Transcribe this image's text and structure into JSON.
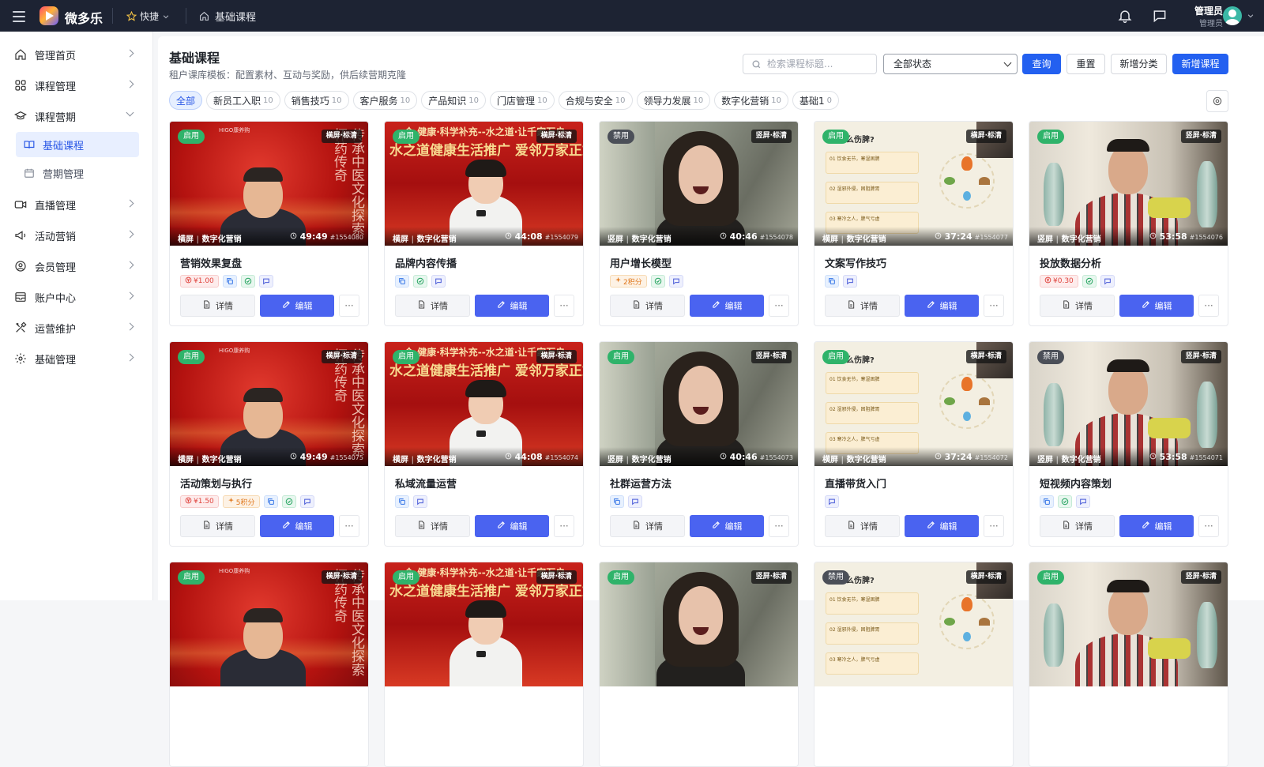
{
  "topbar": {
    "brand": "微多乐",
    "quick": "快捷",
    "crumb": "基础课程",
    "user_name": "管理员",
    "user_role": "管理员"
  },
  "sidebar": {
    "items": [
      {
        "label": "管理首页",
        "icon": "home-icon"
      },
      {
        "label": "课程管理",
        "icon": "grid-icon"
      },
      {
        "label": "课程营期",
        "icon": "graduation-cap-icon"
      },
      {
        "label": "直播管理",
        "icon": "video-icon"
      },
      {
        "label": "活动营销",
        "icon": "megaphone-icon"
      },
      {
        "label": "会员管理",
        "icon": "user-circle-icon"
      },
      {
        "label": "账户中心",
        "icon": "inbox-icon"
      },
      {
        "label": "运营维护",
        "icon": "tools-icon"
      },
      {
        "label": "基础管理",
        "icon": "gear-icon"
      }
    ],
    "sub_items": [
      {
        "label": "基础课程",
        "icon": "book-icon"
      },
      {
        "label": "营期管理",
        "icon": "calendar-icon"
      }
    ]
  },
  "header": {
    "title": "基础课程",
    "subtitle": "租户课库模板：配置素材、互动与奖励，供后续营期克隆",
    "search_placeholder": "检索课程标题...",
    "status_select": "全部状态",
    "query": "查询",
    "reset": "重置",
    "add_category": "新增分类",
    "add_course": "新增课程"
  },
  "categories": [
    {
      "label": "全部",
      "count": ""
    },
    {
      "label": "新员工入职",
      "count": "10"
    },
    {
      "label": "销售技巧",
      "count": "10"
    },
    {
      "label": "客户服务",
      "count": "10"
    },
    {
      "label": "产品知识",
      "count": "10"
    },
    {
      "label": "门店管理",
      "count": "10"
    },
    {
      "label": "合规与安全",
      "count": "10"
    },
    {
      "label": "领导力发展",
      "count": "10"
    },
    {
      "label": "数字化营销",
      "count": "10"
    },
    {
      "label": "基础1",
      "count": "0"
    }
  ],
  "labels": {
    "detail": "详情",
    "edit": "编辑",
    "more": "···"
  },
  "thumb_text": {
    "brand_small": "HIGO康养购",
    "calli": "传承中医文化探索怀药传奇",
    "banner_small": "合·健康·科学补充--水之道·让千家万户",
    "banner_big": "水之道健康生活推广 爱邻万家正式启动",
    "slide_title": "怎么伤脾?",
    "slide_lines": [
      "01 饮食无节，寒湿困脾",
      "02 湿邪外侵，困阻脾胃",
      "03 寒冷之人，脾气亏虚"
    ]
  },
  "cards": [
    {
      "title": "营销效果复盘",
      "status": "启用",
      "format": "横屏·标清",
      "tag": "横屏",
      "cat": "数字化营销",
      "dur": "49:49",
      "id": "#1554080",
      "thumb": "red",
      "price": "¥1.00",
      "points": "",
      "copy": true,
      "check": true,
      "msg": true
    },
    {
      "title": "品牌内容传播",
      "status": "启用",
      "format": "横屏·标清",
      "tag": "横屏",
      "cat": "数字化营销",
      "dur": "44:08",
      "id": "#1554079",
      "thumb": "red2",
      "price": "",
      "points": "",
      "copy": true,
      "check": true,
      "msg": true
    },
    {
      "title": "用户增长模型",
      "status": "禁用",
      "format": "竖屏·标清",
      "tag": "竖屏",
      "cat": "数字化营销",
      "dur": "40:46",
      "id": "#1554078",
      "thumb": "grey",
      "price": "",
      "points": "2积分",
      "copy": false,
      "check": true,
      "msg": true
    },
    {
      "title": "文案写作技巧",
      "status": "启用",
      "format": "横屏·标清",
      "tag": "横屏",
      "cat": "数字化营销",
      "dur": "37:24",
      "id": "#1554077",
      "thumb": "cream",
      "price": "",
      "points": "",
      "copy": true,
      "check": false,
      "msg": true
    },
    {
      "title": "投放数据分析",
      "status": "启用",
      "format": "竖屏·标清",
      "tag": "竖屏",
      "cat": "数字化营销",
      "dur": "53:58",
      "id": "#1554076",
      "thumb": "room",
      "price": "¥0.30",
      "points": "",
      "copy": false,
      "check": true,
      "msg": true
    },
    {
      "title": "活动策划与执行",
      "status": "启用",
      "format": "横屏·标清",
      "tag": "横屏",
      "cat": "数字化营销",
      "dur": "49:49",
      "id": "#1554075",
      "thumb": "red",
      "price": "¥1.50",
      "points": "5积分",
      "copy": true,
      "check": true,
      "msg": true
    },
    {
      "title": "私域流量运营",
      "status": "启用",
      "format": "横屏·标清",
      "tag": "横屏",
      "cat": "数字化营销",
      "dur": "44:08",
      "id": "#1554074",
      "thumb": "red2",
      "price": "",
      "points": "",
      "copy": true,
      "check": false,
      "msg": true
    },
    {
      "title": "社群运营方法",
      "status": "启用",
      "format": "竖屏·标清",
      "tag": "竖屏",
      "cat": "数字化营销",
      "dur": "40:46",
      "id": "#1554073",
      "thumb": "grey",
      "price": "",
      "points": "",
      "copy": true,
      "check": false,
      "msg": true
    },
    {
      "title": "直播带货入门",
      "status": "启用",
      "format": "横屏·标清",
      "tag": "横屏",
      "cat": "数字化营销",
      "dur": "37:24",
      "id": "#1554072",
      "thumb": "cream",
      "price": "",
      "points": "",
      "copy": false,
      "check": false,
      "msg": true
    },
    {
      "title": "短视频内容策划",
      "status": "禁用",
      "format": "竖屏·标清",
      "tag": "竖屏",
      "cat": "数字化营销",
      "dur": "53:58",
      "id": "#1554071",
      "thumb": "room",
      "price": "",
      "points": "",
      "copy": true,
      "check": true,
      "msg": true
    },
    {
      "status": "启用",
      "format": "横屏·标清",
      "thumb": "red"
    },
    {
      "status": "启用",
      "format": "横屏·标清",
      "thumb": "red2"
    },
    {
      "status": "启用",
      "format": "竖屏·标清",
      "thumb": "grey"
    },
    {
      "status": "禁用",
      "format": "横屏·标清",
      "thumb": "cream"
    },
    {
      "status": "启用",
      "format": "竖屏·标清",
      "thumb": "room"
    }
  ]
}
